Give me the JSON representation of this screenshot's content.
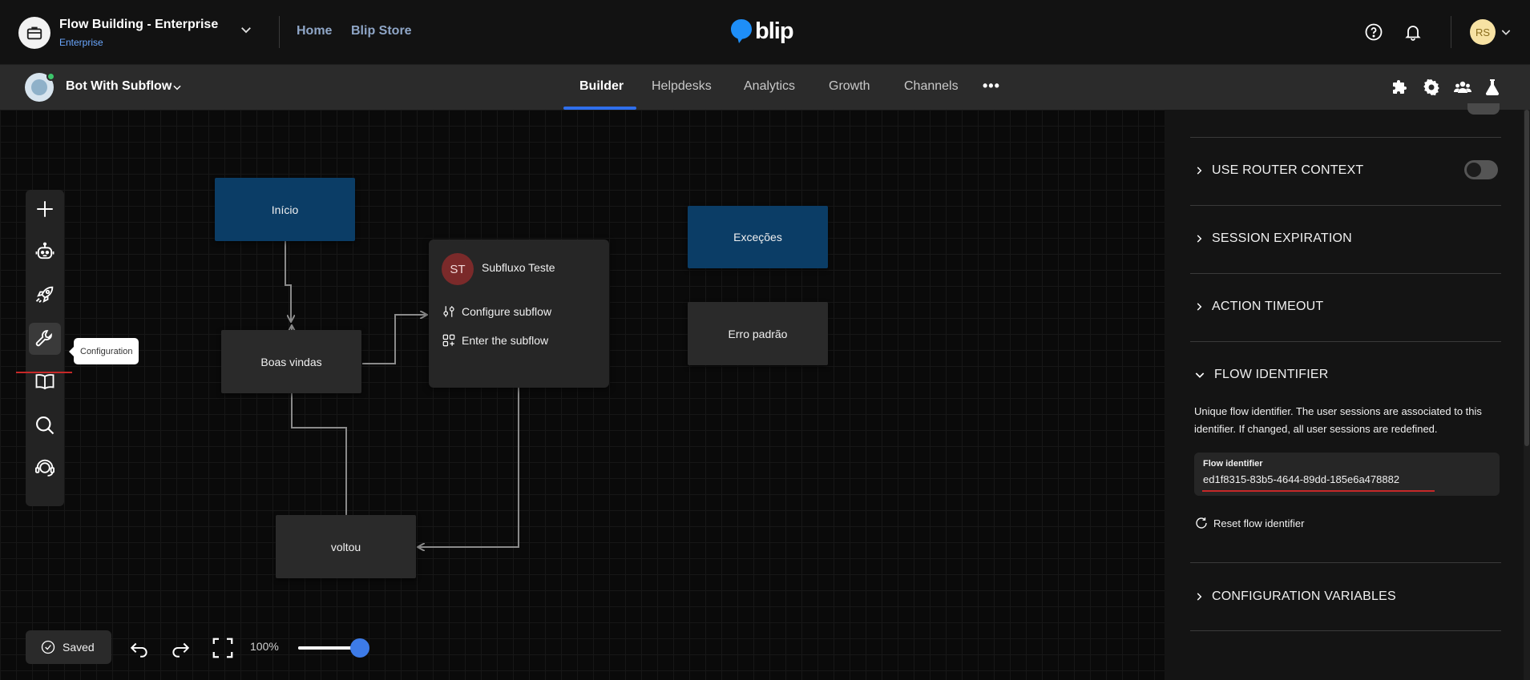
{
  "topbar": {
    "workspace_title": "Flow Building - Enterprise",
    "workspace_subtitle": "Enterprise",
    "links": [
      "Home",
      "Blip Store"
    ],
    "logo_text": "blip",
    "avatar_initials": "RS"
  },
  "botbar": {
    "bot_name": "Bot With Subflow",
    "tabs": [
      "Builder",
      "Helpdesks",
      "Analytics",
      "Growth",
      "Channels"
    ],
    "active_tab": "Builder",
    "more_label": "•••"
  },
  "canvas": {
    "tooltip": "Configuration",
    "nodes": {
      "inicio": "Início",
      "boas_vindas": "Boas vindas",
      "excecoes": "Exceções",
      "erro_padrao": "Erro padrão",
      "voltou": "voltou"
    },
    "subflow": {
      "initials": "ST",
      "title": "Subfluxo Teste",
      "configure": "Configure subflow",
      "enter": "Enter the subflow"
    },
    "saved_label": "Saved",
    "zoom_label": "100%",
    "zoom_fraction": 0.85
  },
  "panel": {
    "sections": {
      "router_context": "USE ROUTER CONTEXT",
      "session_expiration": "SESSION EXPIRATION",
      "action_timeout": "ACTION TIMEOUT",
      "flow_identifier": "FLOW IDENTIFIER",
      "config_vars": "CONFIGURATION VARIABLES"
    },
    "router_context_enabled": false,
    "flow_identifier_desc": "Unique flow identifier. The user sessions are associated to this identifier. If changed, all user sessions are redefined.",
    "field_label": "Flow identifier",
    "field_value": "ed1f8315-83b5-4644-89dd-185e6a478882",
    "reset_label": "Reset flow identifier"
  },
  "colors": {
    "accent": "#2f6fed",
    "node_blue": "#0b3d66",
    "error_red": "#c62828"
  }
}
